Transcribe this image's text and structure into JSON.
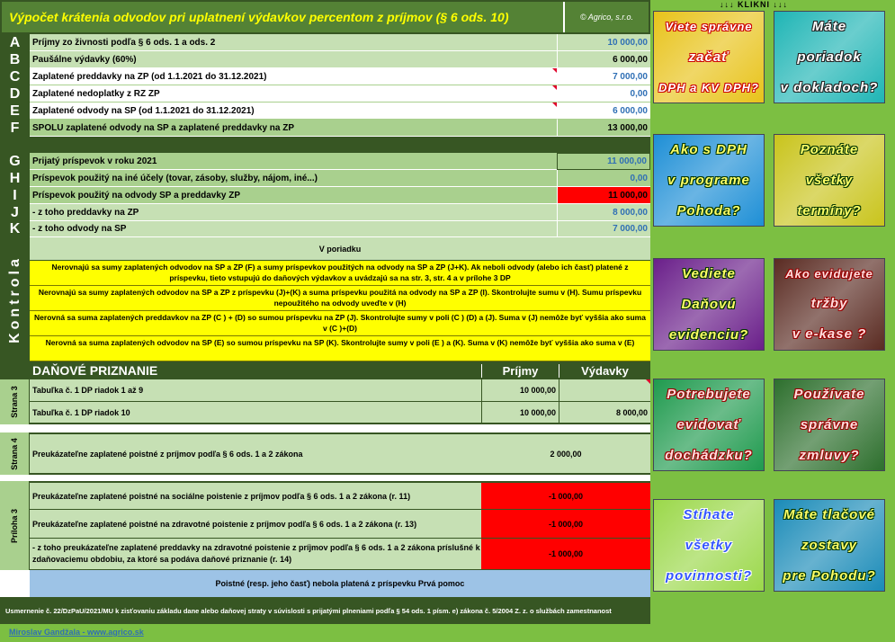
{
  "title": "Výpočet krátenia odvodov pri uplatnení výdavkov percentom z príjmov (§ 6 ods. 10)",
  "copyright": "© Agrico, s.r.o.",
  "rows": [
    {
      "letter": "A",
      "label": "Príjmy zo živnosti podľa § 6 ods. 1 a ods. 2",
      "value": "10 000,00"
    },
    {
      "letter": "B",
      "label": "Paušálne výdavky (60%)",
      "value": "6 000,00"
    },
    {
      "letter": "C",
      "label": "Zaplatené preddavky na ZP (od 1.1.2021 do 31.12.2021)",
      "value": "7 000,00"
    },
    {
      "letter": "D",
      "label": "Zaplatené nedoplatky z RZ ZP",
      "value": "0,00"
    },
    {
      "letter": "E",
      "label": "Zaplatené odvody na SP (od 1.1.2021 do 31.12.2021)",
      "value": "6 000,00"
    },
    {
      "letter": "F",
      "label": "SPOLU zaplatené odvody na SP a zaplatené preddavky na ZP",
      "value": "13 000,00"
    },
    {
      "letter": "G",
      "label": "Prijatý príspevok v roku 2021",
      "value": "11 000,00"
    },
    {
      "letter": "H",
      "label": "Príspevok použitý na iné účely (tovar, zásoby, služby, nájom, iné...)",
      "value": "0,00"
    },
    {
      "letter": "I",
      "label": "Príspevok použitý na odvody SP a preddavky ZP",
      "value": "11 000,00"
    },
    {
      "letter": "J",
      "label": " - z toho preddavky na ZP",
      "value": "8 000,00"
    },
    {
      "letter": "K",
      "label": " - z toho odvody na SP",
      "value": "7 000,00"
    }
  ],
  "kontrola": {
    "side_label": "Kontrola",
    "ok": "V poriadku",
    "warnings": [
      "Nerovnajú sa sumy zaplatených odvodov na SP a ZP (F) a sumy príspevkov použitých na odvody na SP a ZP (J+K). Ak neboli odvody (alebo ich časť) platené z príspevku, tieto vstupujú do daňových výdavkov a uvádzajú sa na str. 3, str. 4 a v prílohe 3 DP",
      "Nerovnajú sa sumy zaplatených odvodov na SP a ZP z príspevku (J)+(K) a suma príspevku použitá na odvody na SP a ZP (I). Skontrolujte sumu v (H). Sumu príspevku nepoužitého na odvody uveďte v (H)",
      "Nerovná sa suma zaplatených preddavkov na ZP (C ) + (D) so sumou príspevku na ZP (J). Skontrolujte sumy v poli (C ) (D) a (J). Suma v (J) nemôže byť vyššia ako suma v (C )+(D)",
      "Nerovná sa suma zaplatených odvodov na SP (E) so sumou príspevku na SP (K). Skontrolujte sumy v poli (E ) a (K). Suma v (K) nemôže byť vyššia ako suma v (E)"
    ]
  },
  "dp": {
    "title": "DAŇOVÉ PRIZNANIE",
    "col_prijmy": "Príjmy",
    "col_vydavky": "Výdavky",
    "strana3": "Strana 3",
    "strana4": "Strana 4",
    "priloha3": "Príloha 3",
    "s3_rows": [
      {
        "label": "Tabuľka č. 1 DP riadok 1 až 9",
        "prijmy": "10 000,00",
        "vydavky": ""
      },
      {
        "label": "Tabuľka č. 1 DP riadok 10",
        "prijmy": "10 000,00",
        "vydavky": "8 000,00"
      }
    ],
    "s4_row": {
      "label": "Preukázateľne zaplatené poistné z príjmov podľa § 6 ods. 1 a 2 zákona",
      "value": "2 000,00"
    },
    "p3_rows": [
      {
        "label": "Preukázateľne zaplatené poistné na sociálne poistenie z príjmov podľa § 6 ods. 1 a 2 zákona (r. 11)",
        "value": "-1 000,00"
      },
      {
        "label": "Preukázateľne zaplatené poistné na zdravotné poistenie z príjmov podľa § 6 ods. 1 a 2 zákona (r. 13)",
        "value": "-1 000,00"
      },
      {
        "label": " - z toho preukázateľne zaplatené preddavky na zdravotné poistenie z príjmov podľa § 6 ods. 1 a 2 zákona príslušné k zdaňovaciemu obdobiu, za ktoré sa podáva daňové priznanie (r. 14)",
        "value": "-1 000,00"
      }
    ],
    "note": "Poistné (resp. jeho časť) nebola platená z príspevku Prvá pomoc"
  },
  "footer_note": "Usmernenie č. 22/DzPaU/2021/MU k zisťovaniu základu dane alebo daňovej straty v súvislosti s prijatými plneniami podľa § 54 ods. 1 písm. e) zákona č. 5/2004 Z. z. o službách zamestnanost",
  "author_link": "Miroslav Gandžala - www.agrico.sk",
  "klikni": "↓↓↓ KLIKNI ↓↓↓",
  "promos": [
    {
      "lines": [
        "Viete správne",
        "začať",
        "DPH a KV DPH?"
      ],
      "bg": "#e8c31a",
      "style": "outline-red"
    },
    {
      "lines": [
        "Máte",
        "poriadok",
        "v dokladoch?"
      ],
      "bg": "#1fb5b5",
      "style": "outline-dark"
    },
    {
      "lines": [
        "Ako s DPH",
        "v programe",
        "Pohoda?"
      ],
      "bg": "#1e8fd6",
      "style": "outline-yellow"
    },
    {
      "lines": [
        "Poznáte",
        "všetky",
        "termíny?"
      ],
      "bg": "#c9c41c",
      "style": "outline-yellow"
    },
    {
      "lines": [
        "Vediete",
        "Daňovú",
        "evidenciu?"
      ],
      "bg": "#6a1f8a",
      "style": "outline-yellow"
    },
    {
      "lines": [
        "Ako evidujete",
        "tržby",
        "v e-kase ?"
      ],
      "bg": "#5a2b22",
      "style": "outline-pink"
    },
    {
      "lines": [
        "Potrebujete",
        "evidovať",
        "dochádzku?"
      ],
      "bg": "#1f9a4e",
      "style": "outline-pink"
    },
    {
      "lines": [
        "Používate",
        "správne",
        "zmluvy?"
      ],
      "bg": "#2d6f2d",
      "style": "outline-pink"
    },
    {
      "lines": [
        "Stíhate",
        "všetky",
        "povinnosti?"
      ],
      "bg": "#9bd84a",
      "style": "outline-blue"
    },
    {
      "lines": [
        "Máte tlačové",
        "zostavy",
        "pre Pohodu?"
      ],
      "bg": "#1a8bb8",
      "style": "outline-yellow"
    }
  ]
}
